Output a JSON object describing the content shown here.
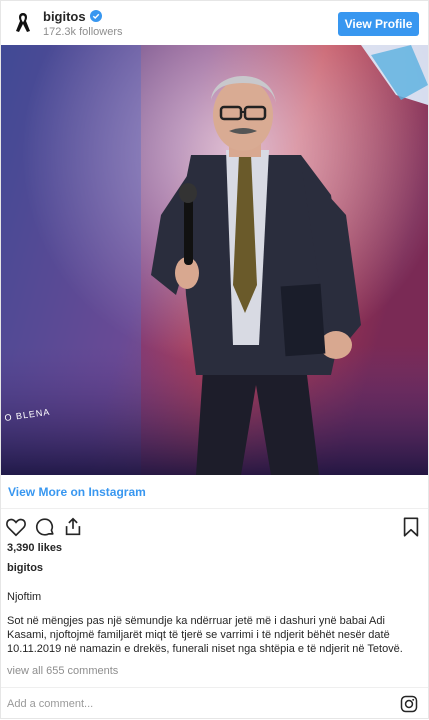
{
  "header": {
    "username": "bigitos",
    "followers": "172.3k followers",
    "view_profile_label": "View Profile",
    "avatar_icon": "black-ribbon-icon",
    "verified_icon": "verified-badge-icon"
  },
  "photo": {
    "watermark": "O BLENA"
  },
  "post": {
    "view_more_label": "View More on Instagram",
    "likes": "3,390 likes",
    "author": "bigitos",
    "caption_title": "Njoftim",
    "caption_body": "Sot në mëngjes pas një sëmundje ka ndërruar jetë më i dashuri ynë babai Adi Kasami, njoftojmë familjarët miqt të tjerë se varrimi i të ndjerit bëhët nesër datë 10.11.2019 në namazin e drekës, funerali niset nga shtëpia e të ndjerit në Tetovë.",
    "view_comments": "view all 655 comments"
  },
  "comment": {
    "placeholder": "Add a comment..."
  },
  "colors": {
    "accent": "#3897f0",
    "muted": "#8e8e8e"
  }
}
